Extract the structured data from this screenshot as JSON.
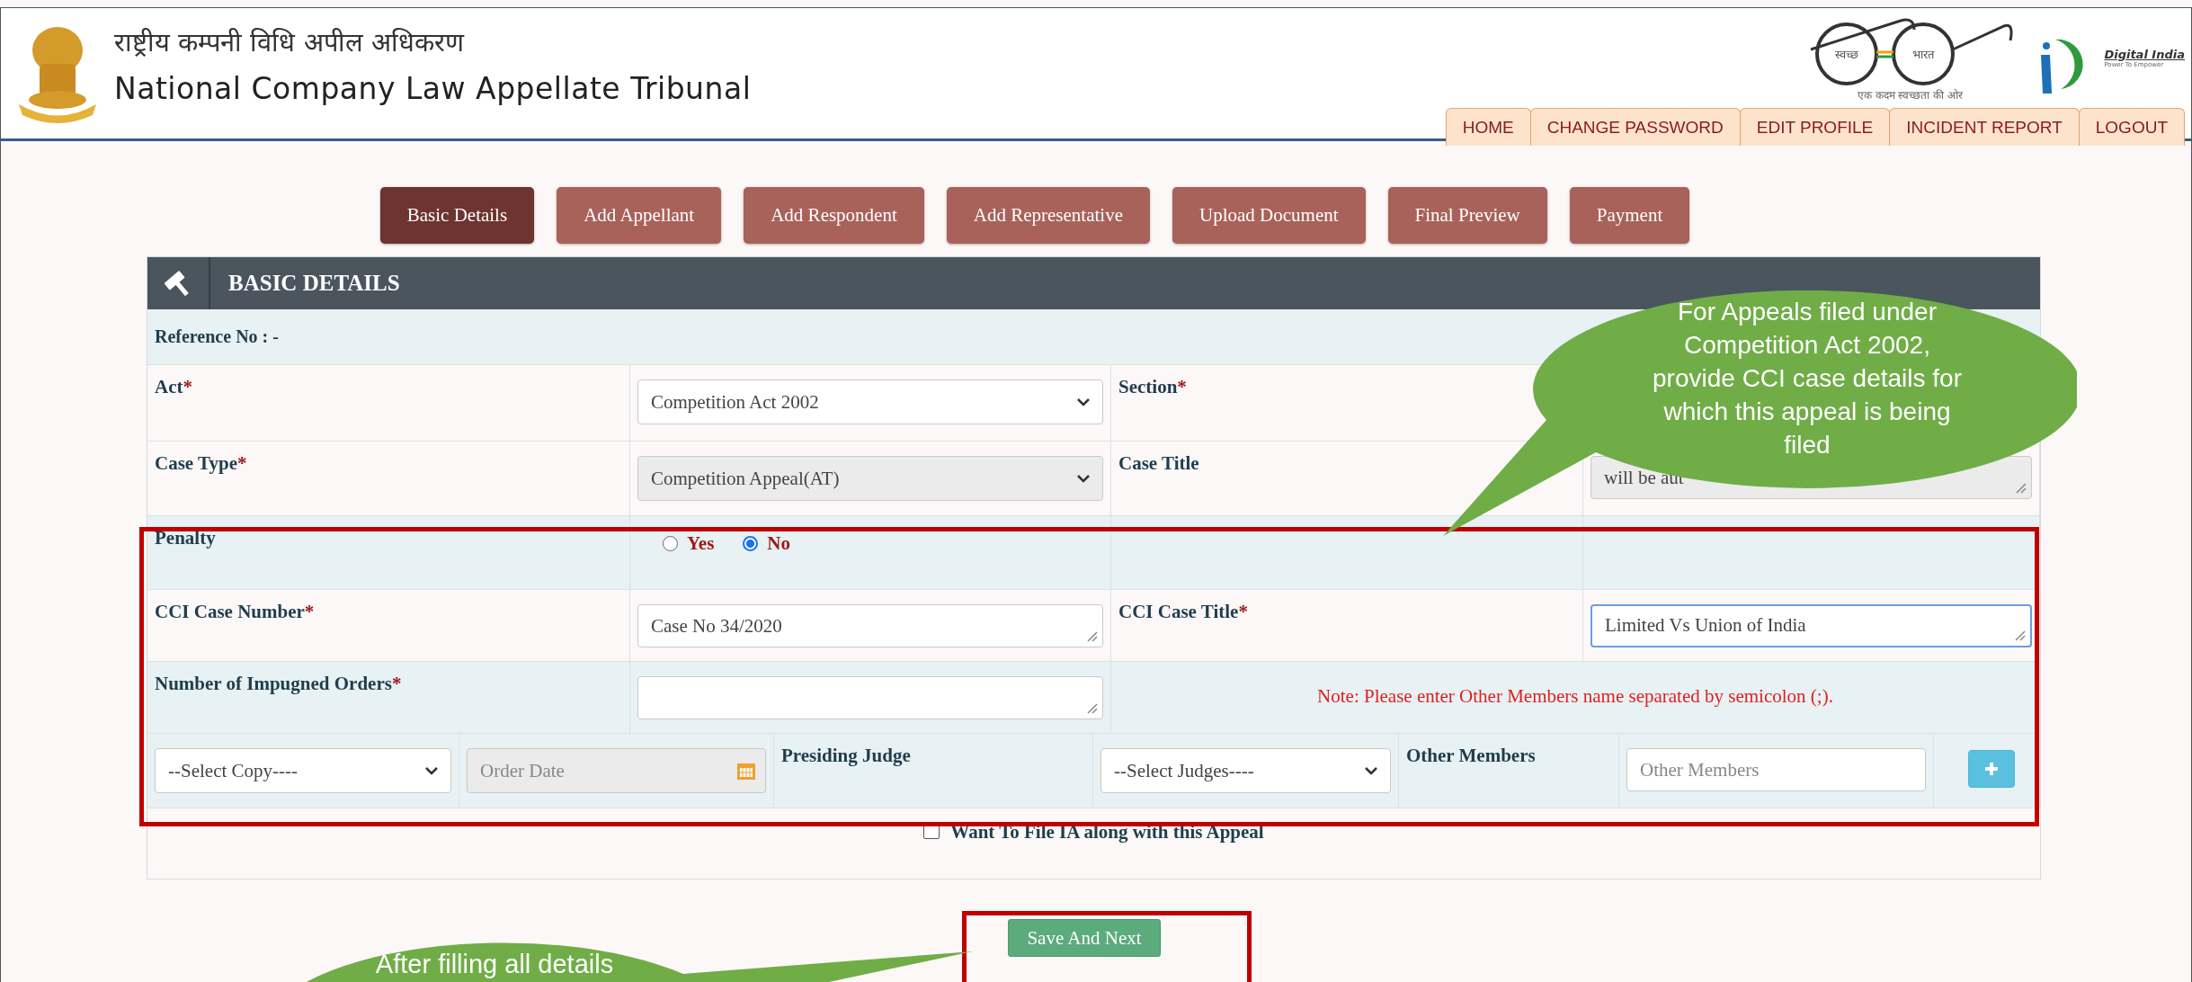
{
  "header": {
    "title_hindi": "राष्ट्रीय कम्पनी विधि अपील अधिकरण",
    "title": "National Company Law Appellate Tribunal",
    "swachh_left": "स्वच्छ",
    "swachh_right": "भारत",
    "swachh_tagline": "एक कदम स्वच्छता की ओर",
    "digital_title": "Digital India",
    "digital_tagline": "Power To Empower"
  },
  "nav": [
    {
      "label": "HOME"
    },
    {
      "label": "CHANGE PASSWORD"
    },
    {
      "label": "EDIT PROFILE"
    },
    {
      "label": "INCIDENT REPORT"
    },
    {
      "label": "LOGOUT"
    }
  ],
  "tabs": [
    {
      "label": "Basic Details",
      "selected": true
    },
    {
      "label": "Add Appellant",
      "selected": false
    },
    {
      "label": "Add Respondent",
      "selected": false
    },
    {
      "label": "Add Representative",
      "selected": false
    },
    {
      "label": "Upload Document",
      "selected": false
    },
    {
      "label": "Final Preview",
      "selected": false
    },
    {
      "label": "Payment",
      "selected": false
    }
  ],
  "panel": {
    "title": "BASIC DETAILS",
    "reference": "Reference No : -",
    "rows": [
      {
        "cells": [
          {
            "kind": "label",
            "text": "Act",
            "mark": "*"
          },
          {
            "kind": "select",
            "value": "Competition Act 2002",
            "disabled": false
          },
          {
            "kind": "label",
            "text": "Section",
            "mark": "*"
          },
          {
            "kind": "empty"
          }
        ]
      },
      {
        "cells": [
          {
            "kind": "label",
            "text": "Case Type",
            "mark": "*"
          },
          {
            "kind": "select",
            "value": "Competition Appeal(AT)",
            "disabled": true
          },
          {
            "kind": "label",
            "text": "Case Title"
          },
          {
            "kind": "textarea",
            "value": "will be aut",
            "disabled": true,
            "focused": false
          }
        ]
      },
      {
        "cells": [
          {
            "kind": "label",
            "text": "Penalty"
          },
          {
            "kind": "radio_group",
            "options": [
              {
                "label": "Yes",
                "selected": false
              },
              {
                "label": "No",
                "selected": true
              }
            ]
          },
          {
            "kind": "empty"
          },
          {
            "kind": "empty"
          }
        ]
      },
      {
        "cells": [
          {
            "kind": "label",
            "text": "CCI Case Number",
            "mark": "*"
          },
          {
            "kind": "textarea",
            "value": "Case No 34/2020",
            "disabled": false,
            "focused": false
          },
          {
            "kind": "label",
            "text": "CCI Case Title",
            "mark": "*"
          },
          {
            "kind": "textarea",
            "value": "Limited Vs Union of India",
            "disabled": false,
            "focused": true
          }
        ]
      },
      {
        "cells": [
          {
            "kind": "label",
            "text": "Number of Impugned Orders",
            "mark": "*"
          },
          {
            "kind": "textarea",
            "disabled": false,
            "focused": false
          }
        ],
        "note": "Note: Please enter Other Members name separated by semicolon (;)."
      }
    ],
    "order_row": {
      "cells": [
        {
          "kind": "select",
          "value": "--Select Copy----",
          "disabled": false
        },
        {
          "kind": "date",
          "placeholder": "Order Date"
        },
        {
          "kind": "label",
          "text": "Presiding Judge"
        },
        {
          "kind": "select",
          "value": "--Select Judges----",
          "disabled": false
        },
        {
          "kind": "label",
          "text": "Other Members"
        },
        {
          "kind": "input",
          "placeholder": "Other Members"
        },
        {
          "kind": "add_button"
        }
      ]
    },
    "ia_checkbox": {
      "label": "Want To File IA along with this Appeal",
      "checked": false
    }
  },
  "save_button": "Save And Next",
  "callouts": [
    {
      "kind": "top",
      "lines": [
        "For Appeals filed under",
        "Competition Act 2002,",
        "provide CCI case details for",
        "which this appeal is being",
        "filed"
      ]
    },
    {
      "kind": "bottom",
      "lines": [
        "After filling all details"
      ]
    }
  ]
}
